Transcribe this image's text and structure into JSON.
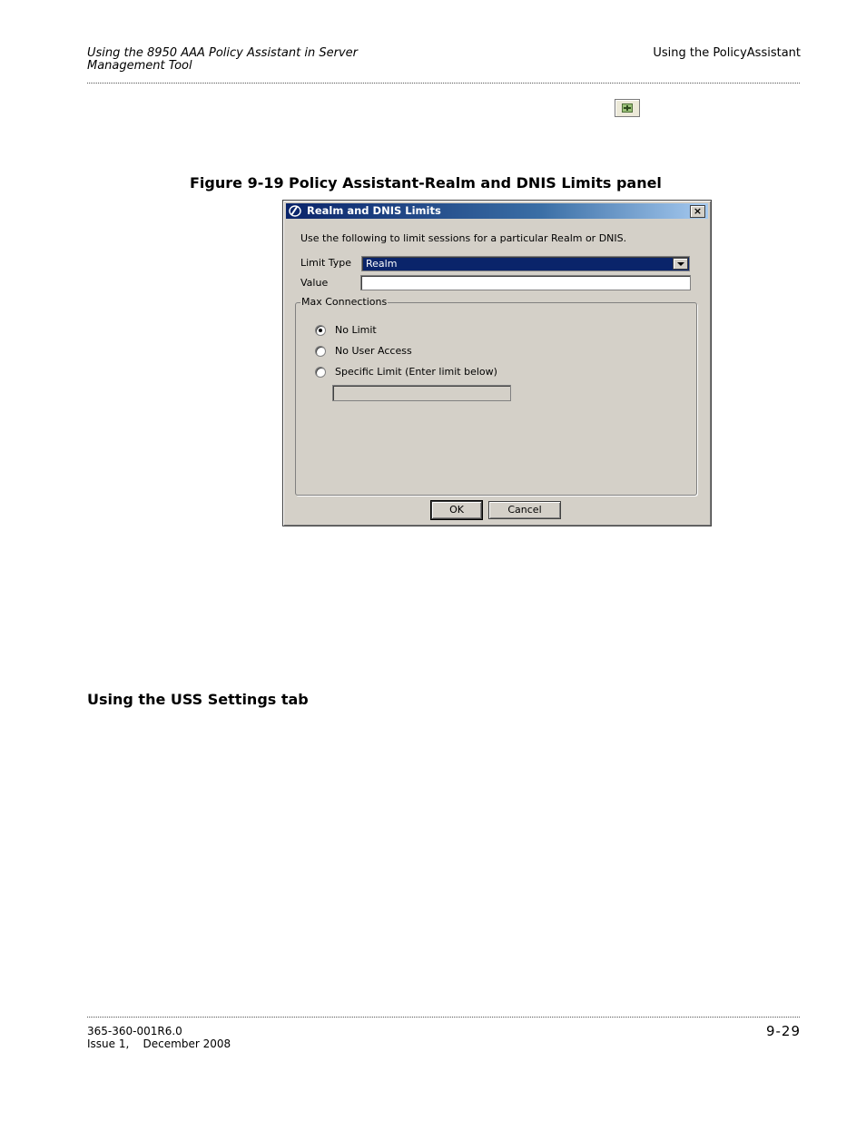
{
  "header": {
    "left_line1": "Using the 8950 AAA Policy Assistant in Server",
    "left_line2": "Management Tool",
    "right": "Using the PolicyAssistant"
  },
  "toolbar_icon": "add-icon",
  "figure": {
    "number": "Figure 9-19",
    "caption": "Policy Assistant-Realm and DNIS Limits panel"
  },
  "dialog": {
    "title": "Realm and DNIS Limits",
    "close_glyph": "×",
    "intro": "Use the following to limit sessions for a particular Realm or DNIS.",
    "limit_type_label": "Limit Type",
    "limit_type_value": "Realm",
    "value_label": "Value",
    "value": "",
    "group_label": "Max Connections",
    "options": [
      {
        "label": "No Limit",
        "checked": true
      },
      {
        "label": "No User Access",
        "checked": false
      },
      {
        "label": "Specific Limit (Enter limit below)",
        "checked": false
      }
    ],
    "specific_limit_value": "",
    "ok_label": "OK",
    "cancel_label": "Cancel"
  },
  "section_title": "Using the USS Settings tab",
  "footer": {
    "doc_number": "365-360-001R6.0",
    "issue": "Issue 1,    December 2008",
    "page": "9-29"
  }
}
